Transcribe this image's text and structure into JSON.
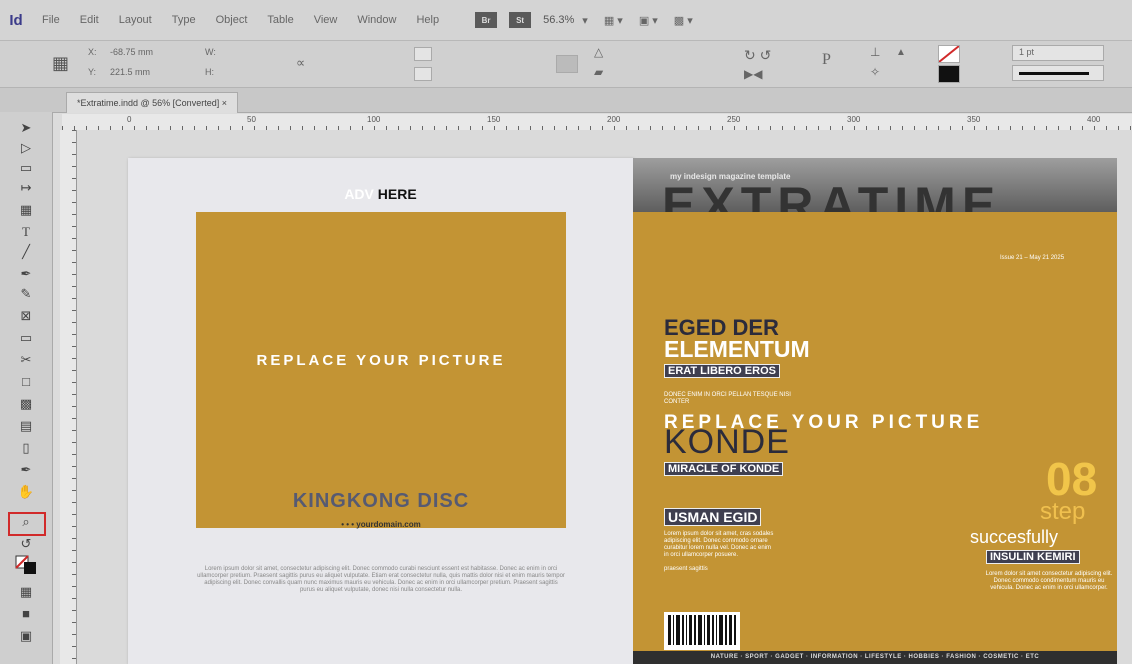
{
  "app": {
    "logo": "Id"
  },
  "menu": [
    "File",
    "Edit",
    "Layout",
    "Type",
    "Object",
    "Table",
    "View",
    "Window",
    "Help"
  ],
  "menubar": {
    "btn1": "Br",
    "btn2": "St",
    "zoom": "56.3%",
    "dd": "—"
  },
  "control": {
    "x_label": "X:",
    "x_value": "-68.75 mm",
    "y_label": "Y:",
    "y_value": "221.5 mm",
    "w_label": "W:",
    "h_label": "H:",
    "stroke_weight": "1 pt"
  },
  "document": {
    "tab_title": "*Extratime.indd @ 56% [Converted]"
  },
  "ruler": {
    "ticks": [
      "0",
      "50",
      "100",
      "150",
      "200",
      "250",
      "300",
      "350",
      "400"
    ]
  },
  "left_page": {
    "adv_prefix": "ADV",
    "adv_suffix": "HERE",
    "picture_placeholder": "REPLACE YOUR PICTURE",
    "kingkong": "KINGKONG DISC",
    "website": "• • • yourdomain.com",
    "body": "Lorem ipsum dolor sit amet, consectetur adipiscing elit. Donec commodo curabi nesciunt essent est habitasse. Donec ac enim in orci ullamcorper pretium. Praesent sagittis purus eu aliquet vulputate. Etiam erat consectetur nulla, quis mattis dolor nisi et enim mauris tempor adipiscing elit. Donec convallis quam nunc maximus mauris eu vehicula. Donec ac enim in orci ullamcorper pretium. Praesent sagittis purus eu aliquet vulputate, donec nisi nulla consectetur nulla."
  },
  "right_page": {
    "subtitle": "my indesign magazine template",
    "title": "EXTRATIME",
    "issue": "Issue 21 – May 21 2025",
    "h1a": "EGED DER",
    "h1b": "ELEMENTUM",
    "tag1": "ERAT LIBERO EROS",
    "small1": "DONEC ENIM IN ORCI PELLAN TESQUE NISI CONTER",
    "pic_text": "REPLACE YOUR PICTURE",
    "konde": "KONDE",
    "tag2": "MIRACLE OF KONDE",
    "tag3": "USMAN EGID",
    "small2": "Lorem ipsum dolor sit amet, cras sodales adipiscing elit. Donec commodo ornare curabitur lorem nulla vel. Donec ac enim in orci ullamcorper posuere.",
    "small2b": "praesent sagittis",
    "num": "08",
    "step": "step",
    "succ": "succesfully",
    "tag4": "INSULIN KEMIRI",
    "small3": "Lorem dolor sit amet consectetur adipiscing elit. Donec commodo condimentum mauris eu vehicula. Donec ac enim in orci ullamcorper.",
    "footer": "NATURE · SPORT · GADGET · INFORMATION · LIFESTYLE · HOBBIES · FASHION · COSMETIC · ETC"
  },
  "colors": {
    "gold": "#c39434",
    "highlight": "#d12a2a"
  }
}
